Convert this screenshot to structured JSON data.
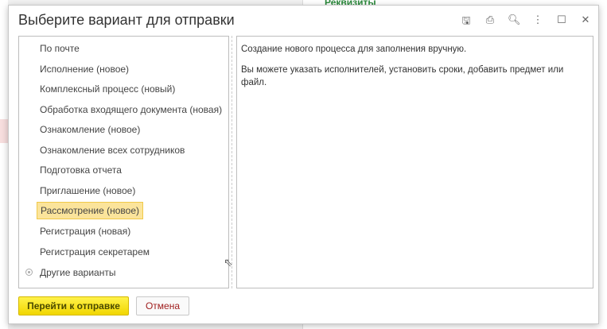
{
  "background": {
    "tab_label": "Реквизиты"
  },
  "dialog": {
    "title": "Выберите вариант для отправки",
    "items": [
      "По почте",
      "Исполнение (новое)",
      "Комплексный процесс (новый)",
      "Обработка входящего документа (новая)",
      "Ознакомление (новое)",
      "Ознакомление всех сотрудников",
      "Подготовка отчета",
      "Приглашение (новое)",
      "Рассмотрение (новое)",
      "Регистрация (новая)",
      "Регистрация секретарем",
      "Другие варианты"
    ],
    "selected_index": 8,
    "description": {
      "line1": "Создание нового процесса для заполнения вручную.",
      "line2": "Вы можете указать исполнителей, установить сроки, добавить предмет или файл."
    },
    "buttons": {
      "submit": "Перейти к отправке",
      "cancel": "Отмена"
    }
  }
}
